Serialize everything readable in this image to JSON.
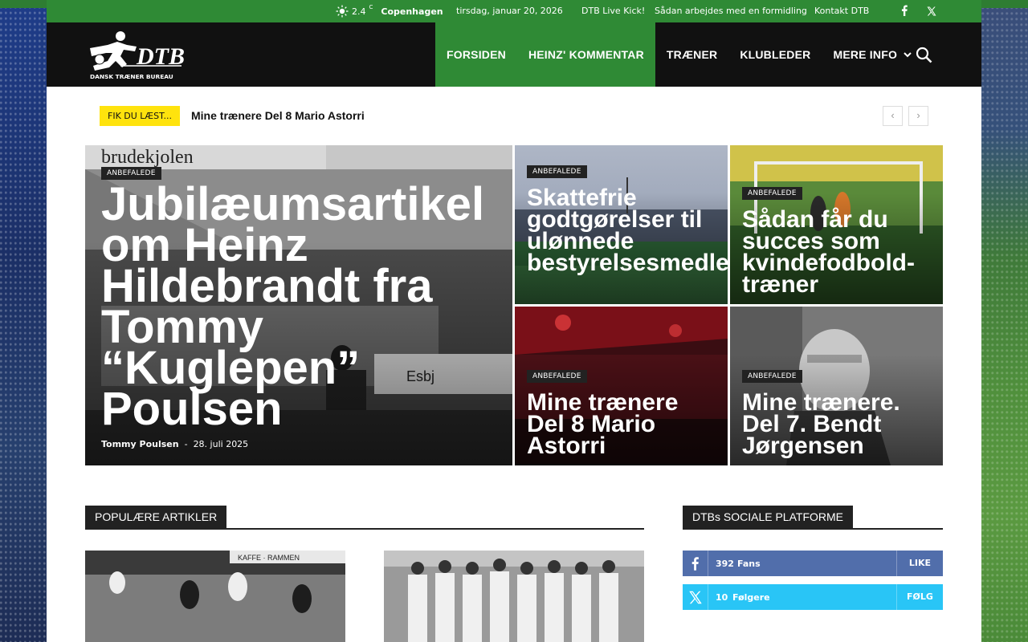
{
  "topbar": {
    "temperature": "2.4",
    "temp_unit": "C",
    "city": "Copenhagen",
    "date": "tirsdag, januar 20, 2026",
    "links": [
      "DTB Live Kick!",
      "Sådan arbejdes med en formidling",
      "Kontakt DTB"
    ],
    "social": [
      "facebook-icon",
      "x-icon"
    ]
  },
  "logo": {
    "text": "DTB",
    "subtitle": "DANSK TRÆNER BUREAU"
  },
  "nav": {
    "items": [
      "FORSIDEN",
      "HEINZ' KOMMENTAR",
      "TRÆNER",
      "KLUBLEDER",
      "MERE INFO"
    ],
    "active_index": 1
  },
  "ticker": {
    "label": "FIK DU LÆST...",
    "headline": "Mine trænere Del 8 Mario Astorri"
  },
  "featured": {
    "big": {
      "category": "ANBEFALEDE",
      "title": "Jubilæumsartikel om Heinz Hildebrandt fra Tommy “Kuglepen” Poulsen",
      "author": "Tommy Poulsen",
      "date": "28. juli 2025"
    },
    "tiles": [
      {
        "category": "ANBEFALEDE",
        "title": "Skattefrie godtgørelser til ulønnede bestyrelsesmedlemmer"
      },
      {
        "category": "ANBEFALEDE",
        "title": "Sådan får du succes som kvindefodbold-træner"
      },
      {
        "category": "ANBEFALEDE",
        "title": "Mine trænere Del 8 Mario Astorri"
      },
      {
        "category": "ANBEFALEDE",
        "title": "Mine trænere. Del 7. Bendt Jørgensen"
      }
    ]
  },
  "sections": {
    "popular": "POPULÆRE ARTIKLER",
    "social": "DTBs SOCIALE PLATFORME"
  },
  "social_platforms": [
    {
      "icon": "facebook-icon",
      "count": "392",
      "kind": "Fans",
      "action": "LIKE",
      "color": "#516eab"
    },
    {
      "icon": "x-icon",
      "count": "10",
      "kind": "Følgere",
      "action": "FØLG",
      "color": "#29c5f6"
    }
  ],
  "colors": {
    "brand_green": "#2f8a35",
    "ticker_yellow": "#ffe30d",
    "dark": "#111111"
  }
}
